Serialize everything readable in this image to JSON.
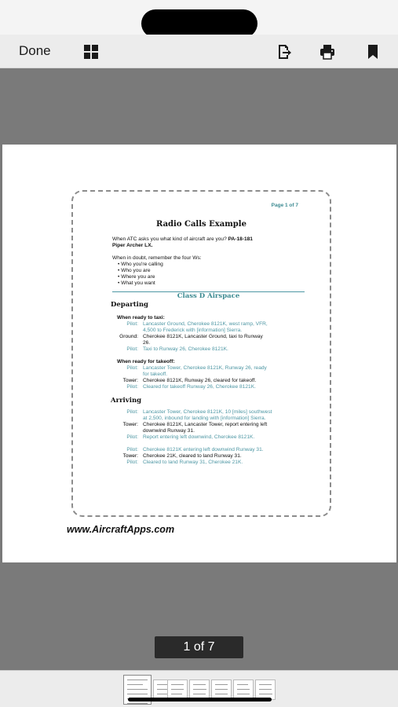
{
  "toolbar": {
    "done_label": "Done"
  },
  "document": {
    "page_label": "Page 1 of 7",
    "title": "Radio Calls Example",
    "intro_line1": "When ATC asks you what kind of aircraft are you? ",
    "intro_bold1": "PA-18-181",
    "intro_bold2": "Piper Archer LX.",
    "doubt_line": "When in doubt, remember the four Ws:",
    "ws": [
      "• Who you're calling",
      "• Who you are",
      "• Where you are",
      "• What you want"
    ],
    "class_heading": "Class D Airspace",
    "departing_heading": "Departing",
    "taxi_heading": "When ready to taxi:",
    "taxi": [
      {
        "role": "Pilot:",
        "text": [
          "Lancaster Ground, Cherokee 8121K, west ramp, VFR,",
          "4,500 to Frederick with [information] Sierra."
        ]
      },
      {
        "role": "Ground:",
        "text": [
          "Cherokee 8121K, Lancaster Ground, taxi to Runway",
          "26."
        ]
      },
      {
        "role": "Pilot:",
        "text": [
          "Taxi to Runway 26, Cherokee 8121K."
        ]
      }
    ],
    "takeoff_heading": "When ready for takeoff:",
    "takeoff": [
      {
        "role": "Pilot:",
        "text": [
          "Lancaster Tower, Cherokee 8121K, Runway 26, ready",
          "for takeoff."
        ]
      },
      {
        "role": "Tower:",
        "text": [
          "Cherokee 8121K, Runway 26, cleared for takeoff."
        ]
      },
      {
        "role": "Pilot:",
        "text": [
          "Cleared for takeoff Runway 26, Cherokee 8121K."
        ]
      }
    ],
    "arriving_heading": "Arriving",
    "arriving": [
      {
        "role": "Pilot:",
        "text": [
          "Lancaster Tower, Cherokee 8121K, 10 [miles] southwest",
          "at 2,500, inbound for landing with [information] Sierra."
        ]
      },
      {
        "role": "Tower:",
        "text": [
          "Cherokee 8121K, Lancaster Tower, report entering left",
          "downwind Runway 31."
        ]
      },
      {
        "role": "Pilot:",
        "text": [
          "Report entering left downwind, Cherokee 8121K."
        ]
      },
      {
        "role": "Pilot:",
        "text": [
          "Cherokee 8121K entering left downwind Runway 31."
        ]
      },
      {
        "role": "Tower:",
        "text": [
          "Cherokee 21K, cleared to land Runway 31."
        ]
      },
      {
        "role": "Pilot:",
        "text": [
          "Cleared to land Runway 31, Cherokee 21K."
        ]
      }
    ],
    "watermark": "www.AircraftApps.com"
  },
  "pager": {
    "label": "1 of 7"
  },
  "colors": {
    "accent_teal": "#4e97a4",
    "toolbar_bg": "#ececec",
    "background": "#7a7a7a"
  }
}
